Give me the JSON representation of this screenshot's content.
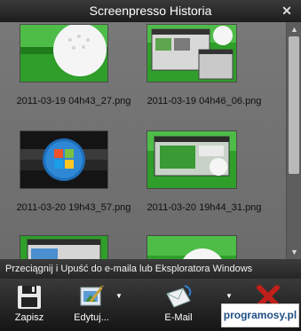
{
  "window": {
    "title": "Screenpresso Historia"
  },
  "gallery": {
    "items": [
      {
        "filename": "2011-03-19 04h43_27.png",
        "thumbnail": "golf-ball-icon"
      },
      {
        "filename": "2011-03-19 04h46_06.png",
        "thumbnail": "window-screenshot-icon"
      },
      {
        "filename": "2011-03-20 19h43_57.png",
        "thumbnail": "windows-start-button-icon"
      },
      {
        "filename": "2011-03-20 19h44_31.png",
        "thumbnail": "window-screenshot-icon"
      },
      {
        "filename": "",
        "thumbnail": "window-screenshot-icon"
      },
      {
        "filename": "",
        "thumbnail": "golf-ball-icon"
      }
    ]
  },
  "status": {
    "text": "Przeciągnij i Upuść do e-maila lub Eksploratora Windows"
  },
  "toolbar": {
    "save_label": "Zapisz",
    "edit_label": "Edytuj...",
    "email_label": "E-Mail",
    "delete_label": ""
  },
  "watermark": {
    "text": "programosy.pl"
  },
  "colors": {
    "accent_red": "#c0201a",
    "grass_green": "#2f9e2a"
  }
}
